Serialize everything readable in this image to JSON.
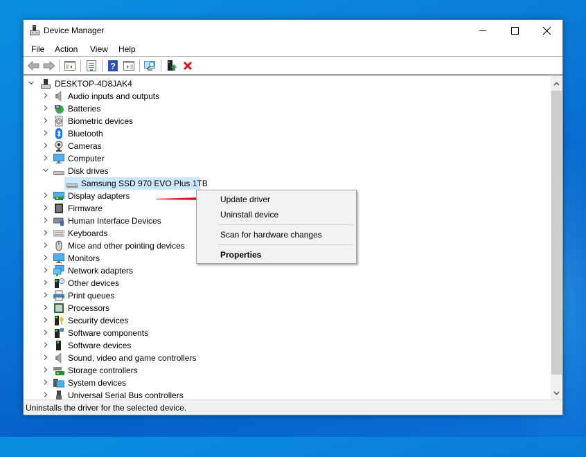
{
  "window": {
    "title": "Device Manager",
    "controls": {
      "minimize": "minimize",
      "maximize": "maximize",
      "close": "close"
    }
  },
  "menubar": {
    "items": [
      {
        "label": "File"
      },
      {
        "label": "Action"
      },
      {
        "label": "View"
      },
      {
        "label": "Help"
      }
    ]
  },
  "toolbar": {
    "buttons": [
      {
        "name": "back",
        "icon": "back-arrow-icon",
        "enabled": false
      },
      {
        "name": "forward",
        "icon": "forward-arrow-icon",
        "enabled": false
      },
      {
        "name": "show-hide-console-tree",
        "icon": "console-tree-icon"
      },
      {
        "name": "properties",
        "icon": "properties-sheet-icon"
      },
      {
        "name": "help",
        "icon": "help-icon"
      },
      {
        "name": "show-hide-action-pane",
        "icon": "action-pane-icon"
      },
      {
        "name": "scan-hardware",
        "icon": "scan-monitor-icon"
      },
      {
        "name": "update-driver",
        "icon": "update-driver-icon"
      },
      {
        "name": "uninstall-device",
        "icon": "red-x-icon"
      }
    ]
  },
  "tree": {
    "root": {
      "label": "DESKTOP-4D8JAK4",
      "expanded": true,
      "icon": "computer-tower-icon"
    },
    "categories": [
      {
        "label": "Audio inputs and outputs",
        "icon": "speaker-icon",
        "expanded": false
      },
      {
        "label": "Batteries",
        "icon": "battery-icon",
        "expanded": false
      },
      {
        "label": "Biometric devices",
        "icon": "fingerprint-icon",
        "expanded": false
      },
      {
        "label": "Bluetooth",
        "icon": "bluetooth-icon",
        "expanded": false
      },
      {
        "label": "Cameras",
        "icon": "camera-icon",
        "expanded": false
      },
      {
        "label": "Computer",
        "icon": "monitor-icon",
        "expanded": false
      },
      {
        "label": "Disk drives",
        "icon": "disk-drive-icon",
        "expanded": true,
        "children": [
          {
            "label": "Samsung SSD 970 EVO Plus 1TB",
            "icon": "disk-drive-icon",
            "selected": true
          }
        ]
      },
      {
        "label": "Display adapters",
        "icon": "display-adapter-icon",
        "expanded": false
      },
      {
        "label": "Firmware",
        "icon": "chip-icon",
        "expanded": false
      },
      {
        "label": "Human Interface Devices",
        "icon": "hid-icon",
        "expanded": false
      },
      {
        "label": "Keyboards",
        "icon": "keyboard-icon",
        "expanded": false
      },
      {
        "label": "Mice and other pointing devices",
        "icon": "mouse-icon",
        "expanded": false
      },
      {
        "label": "Monitors",
        "icon": "monitor-icon",
        "expanded": false
      },
      {
        "label": "Network adapters",
        "icon": "network-icon",
        "expanded": false
      },
      {
        "label": "Other devices",
        "icon": "unknown-device-icon",
        "expanded": false
      },
      {
        "label": "Print queues",
        "icon": "printer-icon",
        "expanded": false
      },
      {
        "label": "Processors",
        "icon": "processor-icon",
        "expanded": false
      },
      {
        "label": "Security devices",
        "icon": "security-key-icon",
        "expanded": false
      },
      {
        "label": "Software components",
        "icon": "software-component-icon",
        "expanded": false
      },
      {
        "label": "Software devices",
        "icon": "software-device-icon",
        "expanded": false
      },
      {
        "label": "Sound, video and game controllers",
        "icon": "speaker-icon",
        "expanded": false
      },
      {
        "label": "Storage controllers",
        "icon": "storage-controller-icon",
        "expanded": false
      },
      {
        "label": "System devices",
        "icon": "system-folder-icon",
        "expanded": false
      },
      {
        "label": "Universal Serial Bus controllers",
        "icon": "usb-icon",
        "expanded": false
      }
    ]
  },
  "context_menu": {
    "items": [
      {
        "label": "Update driver",
        "bold": false
      },
      {
        "label": "Uninstall device",
        "bold": false
      },
      {
        "separator": true
      },
      {
        "label": "Scan for hardware changes",
        "bold": false
      },
      {
        "separator": true
      },
      {
        "label": "Properties",
        "bold": true
      }
    ]
  },
  "annotation": {
    "type": "red-arrow",
    "points_to": "Update driver",
    "color": "#e0161c"
  },
  "statusbar": {
    "text": "Uninstalls the driver for the selected device."
  },
  "colors": {
    "selection": "#cce8ff",
    "desktop": "#0a78d8",
    "menu_bg": "#f2f2f2"
  }
}
